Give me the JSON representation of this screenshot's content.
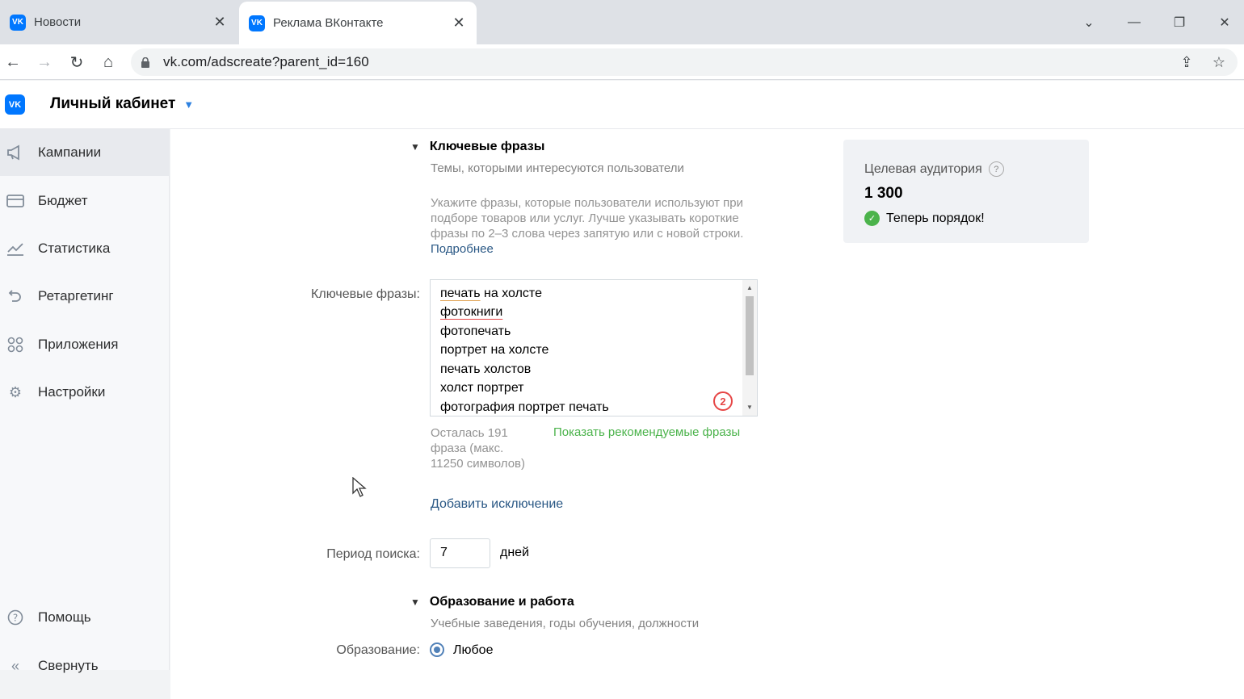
{
  "browser": {
    "tabs": [
      {
        "title": "Новости",
        "favicon": "vk-icon"
      },
      {
        "title": "Реклама ВКонтакте",
        "favicon": "vk-icon"
      }
    ],
    "address": "vk.com/adscreate?parent_id=160"
  },
  "header": {
    "logo": "VK",
    "cabinet": "Личный кабинет"
  },
  "sidebar": {
    "items": [
      {
        "label": "Кампании",
        "icon": "megaphone-icon"
      },
      {
        "label": "Бюджет",
        "icon": "wallet-icon"
      },
      {
        "label": "Статистика",
        "icon": "chart-icon"
      },
      {
        "label": "Ретаргетинг",
        "icon": "retarget-icon"
      },
      {
        "label": "Приложения",
        "icon": "apps-icon"
      },
      {
        "label": "Настройки",
        "icon": "gear-icon"
      }
    ],
    "help": "Помощь",
    "collapse": "Свернуть"
  },
  "keywords": {
    "title": "Ключевые фразы",
    "subtitle": "Темы, которыми интересуются пользователи",
    "hint": "Укажите фразы, которые пользователи используют при подборе товаров или услуг. Лучше указывать короткие фразы по 2–3 слова через запятую или с новой строки.",
    "hint_link": "Подробнее",
    "field_label": "Ключевые фразы:",
    "phrases": [
      "печать",
      "на холсте",
      "фотокниги",
      "фотопечать",
      "портрет на холсте",
      "печать холстов",
      "холст портрет",
      "фотография портрет печать"
    ],
    "badge": "2",
    "remaining": "Осталась 191 фраза (макс. 11250 символов)",
    "recommended": "Показать рекомендуемые фразы",
    "add_exclusion": "Добавить исключение"
  },
  "period": {
    "label": "Период поиска:",
    "value": "7",
    "unit": "дней"
  },
  "education": {
    "title": "Образование и работа",
    "subtitle": "Учебные заведения, годы обучения, должности",
    "label": "Образование:",
    "option": "Любое"
  },
  "audience": {
    "title": "Целевая аудитория",
    "count": "1 300",
    "status": "Теперь порядок!"
  },
  "colors": {
    "vk_blue": "#0077ff",
    "link": "#2a5885",
    "green": "#4bb34b",
    "error": "#e64646"
  }
}
